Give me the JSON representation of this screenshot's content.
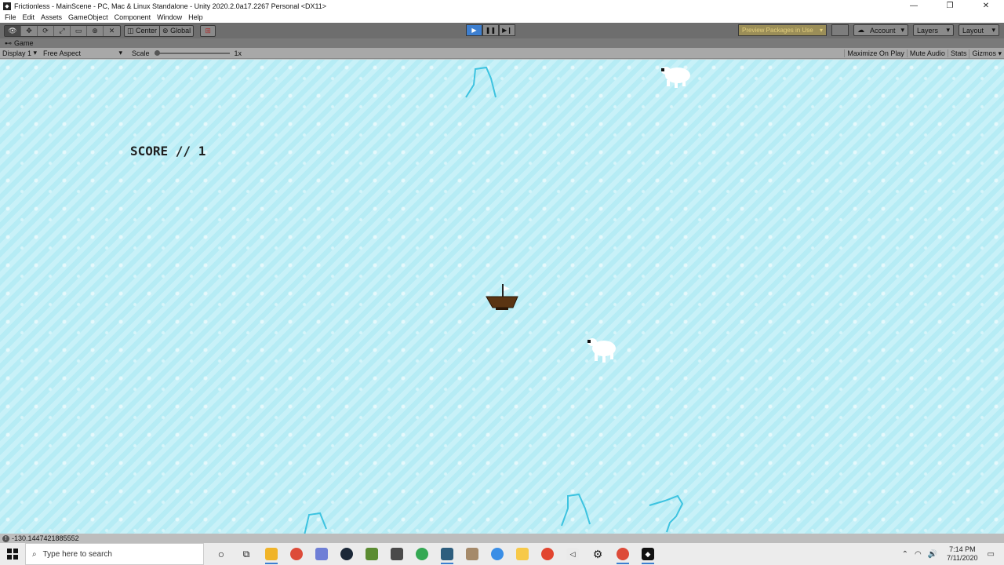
{
  "window": {
    "title": "Frictionless - MainScene - PC, Mac & Linux Standalone - Unity 2020.2.0a17.2267 Personal <DX11>"
  },
  "menu": [
    "File",
    "Edit",
    "Assets",
    "GameObject",
    "Component",
    "Window",
    "Help"
  ],
  "toolbar": {
    "pivot_label": "Center",
    "space_label": "Global",
    "preview_label": "Preview Packages in Use",
    "account_label": "Account",
    "layers_label": "Layers",
    "layout_label": "Layout"
  },
  "game_view": {
    "tab_label": "Game",
    "display_label": "Display 1",
    "aspect_label": "Free Aspect",
    "scale_label": "Scale",
    "scale_value": "1x",
    "maximize_label": "Maximize On Play",
    "mute_label": "Mute Audio",
    "stats_label": "Stats",
    "gizmos_label": "Gizmos"
  },
  "game": {
    "score_text": "SCORE // 1"
  },
  "status": {
    "message": "-130.1447421885552"
  },
  "taskbar": {
    "search_placeholder": "Type here to search",
    "time": "7:14 PM",
    "date": "7/11/2020"
  }
}
